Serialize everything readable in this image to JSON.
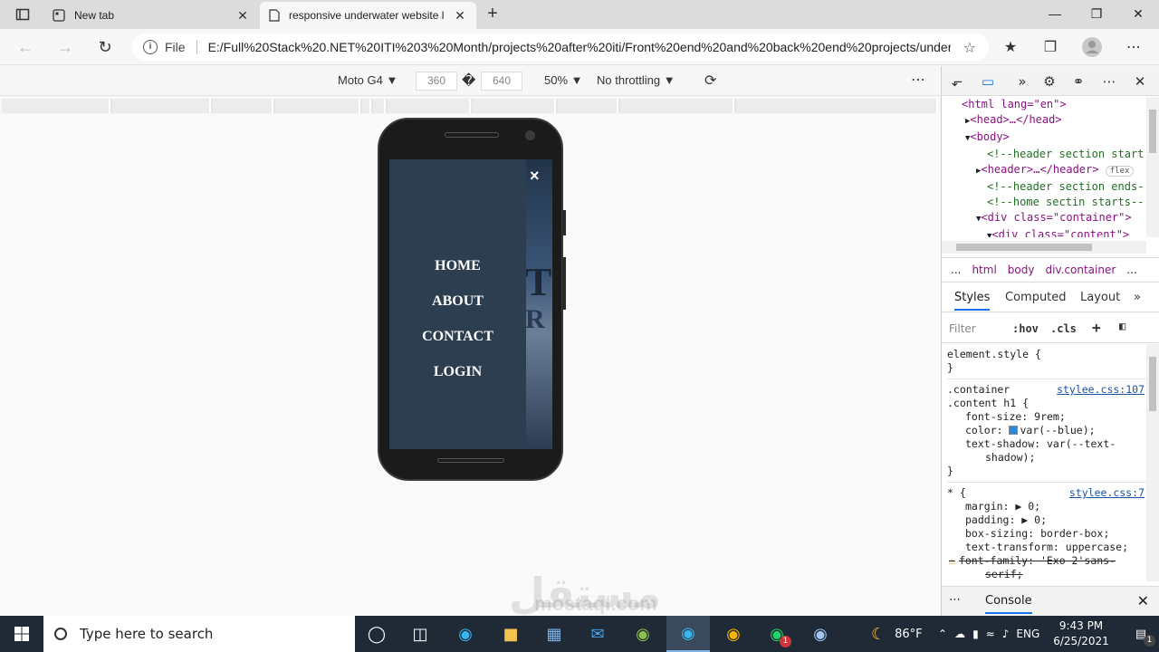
{
  "browser": {
    "tabs": [
      {
        "title": "New tab",
        "active": false
      },
      {
        "title": "responsive underwater website l",
        "active": true
      }
    ],
    "address": {
      "scheme_label": "File",
      "url": "E:/Full%20Stack%20.NET%20ITI%203%20Month/projects%20after%20iti/Front%20end%20and%20back%20end%20projects/under..."
    }
  },
  "device_toolbar": {
    "device": "Moto G4",
    "width": "360",
    "height": "640",
    "dimension_separator": "�",
    "zoom": "50%",
    "throttling": "No throttling"
  },
  "page": {
    "bg_title": "T",
    "bg_sub": "R",
    "menu_close": "×",
    "menu_items": [
      "HOME",
      "ABOUT",
      "CONTACT",
      "LOGIN"
    ]
  },
  "devtools": {
    "breadcrumbs": [
      "...",
      "html",
      "body",
      "div.container",
      "..."
    ],
    "style_tabs": [
      "Styles",
      "Computed",
      "Layout"
    ],
    "filter_placeholder": "Filter",
    "hov": ":hov",
    "cls": ".cls",
    "console_tab": "Console",
    "dom": {
      "l1": "<html lang=\"en\">",
      "l2": "<head>…</head>",
      "l3": "<body>",
      "l4": "<!--header section start",
      "l5": "<header>…</header>",
      "l5_badge": "flex",
      "l6": "<!--header section ends-",
      "l7": "<!--home sectin starts--",
      "l8": "<div class=\"container\">",
      "l9": "<div class=\"content\">"
    },
    "styles": {
      "element_style": "element.style {",
      "close_brace": "}",
      "rule1_selector_a": ".container",
      "rule1_selector_b": ".content h1 {",
      "rule1_source": "stylee.css:107",
      "rule1_decl1": "font-size: 9rem;",
      "rule1_decl2": "var(--blue);",
      "rule1_decl2_prop": "color:",
      "rule1_decl3": "text-shadow: var(--text-",
      "rule1_decl3b": "shadow);",
      "rule2_selector": "* {",
      "rule2_source": "stylee.css:7",
      "rule2_decl1": "margin: ▶ 0;",
      "rule2_decl2": "padding: ▶ 0;",
      "rule2_decl3": "box-sizing: border-box;",
      "rule2_decl4": "text-transform: uppercase;",
      "rule2_decl5": "font-family: 'Exo 2'sans-",
      "rule2_decl5b": "serif;"
    }
  },
  "taskbar": {
    "search_placeholder": "Type here to search",
    "weather": "86°F",
    "language": "ENG",
    "time": "9:43 PM",
    "date": "6/25/2021",
    "whatsapp_badge": "1",
    "notification_badge": "1"
  },
  "watermark": {
    "text": "مستقل",
    "sub": "mostaql.com"
  }
}
